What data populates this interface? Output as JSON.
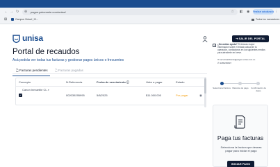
{
  "browser": {
    "url": "pagos.yokommie.com/unisa/",
    "profile_label": "Finalizar actualización",
    "bookmarks": {
      "left": "Campus Virtual | Cl...",
      "right": "Todos los marcadores"
    }
  },
  "header": {
    "logo_text": "unisa",
    "logout_label": "SALIR DEL PORTAL"
  },
  "page": {
    "title": "Portal de recaudos",
    "subtitle": "Acá podrás ver todas tus facturas y gestionar pagos únicos o frecuentes"
  },
  "tabs": [
    {
      "label": "Facturas pendientes",
      "active": true
    },
    {
      "label": "Facturas pagadas",
      "active": false
    }
  ],
  "table": {
    "headers": [
      "Concepto",
      "N.Referencia",
      "Fecha de vencimiento",
      "Valor a pagar",
      "Estado"
    ],
    "rows": [
      {
        "concept": "Canon Inmueble CL",
        "reference": "002039295995",
        "due_date": "5/8/2025",
        "amount": "$11.000.000",
        "status": "Por pagar"
      }
    ]
  },
  "info": {
    "text_bold": "¿Necesitas ayuda?",
    "text_rest": " Si deseas mayor información sobre el estado actual de tu operación, contáctanos en los siguientes medios para atenderte en breve.",
    "email": "servicioalcliente@pagos.unisa.com.co",
    "phone": "3185205837"
  },
  "steps": [
    {
      "label": "Seleccionar factura",
      "active": true
    },
    {
      "label": "Métodos de pago",
      "active": false
    },
    {
      "label": "Confirmación de datos",
      "active": false
    }
  ],
  "pay_card": {
    "title": "Paga tus facturas",
    "description": "Selecciona la factura que deseas pagar para iniciar el pago",
    "button_label": "INICIAR PAGO"
  },
  "colors": {
    "brand": "#1b4d8f",
    "dark_button": "#0f1b33",
    "status_pending": "#f59e0b"
  }
}
